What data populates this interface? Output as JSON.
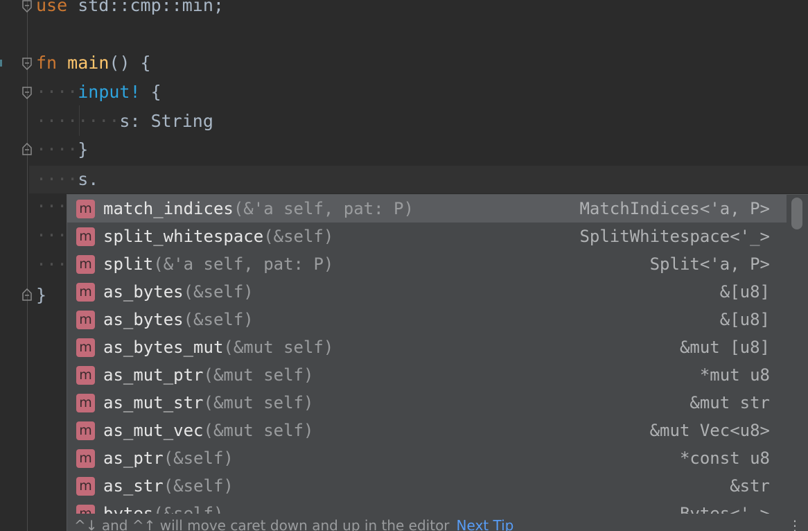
{
  "editor": {
    "lines": {
      "use": {
        "kw": "use",
        "rest": " std::cmp::min;"
      },
      "fn": {
        "kw": "fn",
        "name": "main",
        "rest": "() {"
      },
      "macro": {
        "name": "input!",
        "rest": " {"
      },
      "field": {
        "text": "s: String"
      },
      "close_inner": {
        "text": "}"
      },
      "current": {
        "text": "s."
      },
      "close_outer": {
        "text": "}"
      }
    }
  },
  "completion": {
    "items": [
      {
        "badge": "m",
        "name": "match_indices",
        "sig": "(&'a self, pat: P)",
        "ret": "MatchIndices<'a, P>"
      },
      {
        "badge": "m",
        "name": "split_whitespace",
        "sig": "(&self)",
        "ret": "SplitWhitespace<'_>"
      },
      {
        "badge": "m",
        "name": "split",
        "sig": "(&'a self, pat: P)",
        "ret": "Split<'a, P>"
      },
      {
        "badge": "m",
        "name": "as_bytes",
        "sig": "(&self)",
        "ret": "&[u8]"
      },
      {
        "badge": "m",
        "name": "as_bytes",
        "sig": "(&self)",
        "ret": "&[u8]"
      },
      {
        "badge": "m",
        "name": "as_bytes_mut",
        "sig": "(&mut self)",
        "ret": "&mut [u8]"
      },
      {
        "badge": "m",
        "name": "as_mut_ptr",
        "sig": "(&mut self)",
        "ret": "*mut u8"
      },
      {
        "badge": "m",
        "name": "as_mut_str",
        "sig": "(&mut self)",
        "ret": "&mut str"
      },
      {
        "badge": "m",
        "name": "as_mut_vec",
        "sig": "(&mut self)",
        "ret": "&mut Vec<u8>"
      },
      {
        "badge": "m",
        "name": "as_ptr",
        "sig": "(&self)",
        "ret": "*const u8"
      },
      {
        "badge": "m",
        "name": "as_str",
        "sig": "(&self)",
        "ret": "&str"
      },
      {
        "badge": "m",
        "name": "bytes",
        "sig": "(&self)",
        "ret": "Bytes<'_>"
      }
    ],
    "footer": {
      "hint": "^↓ and ^↑ will move caret down and up in the editor",
      "next_tip": "Next Tip",
      "more": "⋮"
    }
  },
  "colors": {
    "keyword": "#cc7832",
    "function": "#ffc66d",
    "macro": "#2ea4de",
    "text": "#a9b7c6",
    "badge": "#c36b79",
    "link": "#589df6"
  }
}
